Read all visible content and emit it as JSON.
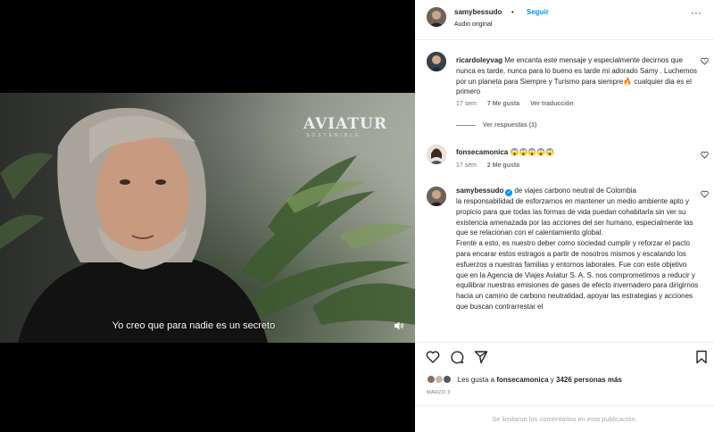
{
  "header": {
    "username": "samybessudo",
    "separator": "•",
    "follow_label": "Seguir",
    "audio_label": "Audio original",
    "more_label": "···"
  },
  "video": {
    "brand": "AVIATUR",
    "brand_sub": "SOSTENIBLE",
    "caption": "Yo creo que para nadie es un secreto"
  },
  "comments": [
    {
      "username": "ricardoleyvag",
      "text": "Me encanta este mensaje y especialmente decirnos que nunca es tarde, nunca para lo bueno es tarde mi adorado Samy . Luchemos por un planeta para Siempre y Turismo para siempre🔥 cualquier dia es el primero",
      "time": "17 sem",
      "likes": "7 Me gusta",
      "translate": "Ver traducción",
      "replies": "Ver respuestas (1)"
    },
    {
      "username": "fonsecamonica",
      "text": "😱😱😱😱😱",
      "time": "17 sem",
      "likes": "2 Me gusta"
    },
    {
      "username": "samybessudo",
      "text": "de viajes carbono neutral de Colombia\nla responsabilidad de esforzarnos en mantener un medio ambiente apto y propicio para que todas las formas de vida puedan cohabitarla sin ver su existencia amenazada por las acciones del ser humano, especialmente las que se relacionan con el calentamiento global.\nFrente a esto, es nuestro deber como sociedad cumplir y reforzar el pacto para encarar estos estragos a partir de nosotros mismos y escalando los esfuerzos a nuestras familias y entornos laborales. Fue con este objetivo que en la Agencia de Viajes Aviatur S. A. S. nos comprometimos a reducir y equilibrar nuestras emisiones de gases de efecto invernadero para dirigirnos hacia un camino de carbono neutralidad, apoyar las estrategias y acciones que buscan contrarrestar el"
    }
  ],
  "likes_row": {
    "prefix": "Les gusta a",
    "user": "fonsecamonica",
    "conj": "y",
    "others": "3426 personas más"
  },
  "date": "MARZO 3",
  "comments_limited": "Se limitaron los comentarios en esta publicación."
}
